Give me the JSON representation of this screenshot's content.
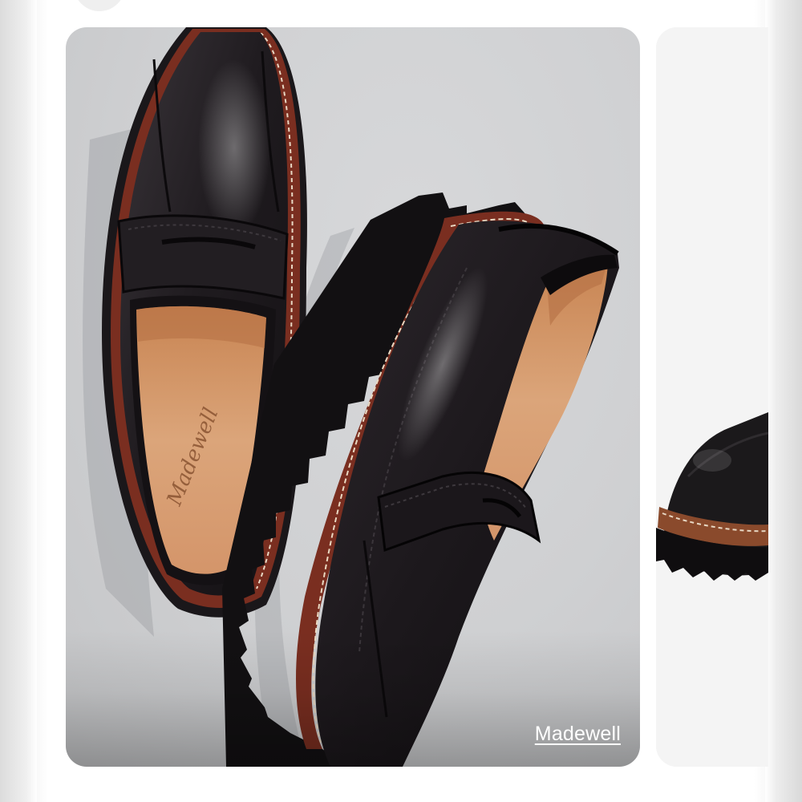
{
  "listing": {
    "primary_card": {
      "brand_link": "Madewell",
      "insole_logo": "Madewell",
      "image_subject": "black-leather-lug-sole-loafers"
    },
    "next_card": {
      "image_subject": "black-leather-lug-sole-loafer-partial"
    }
  },
  "colors": {
    "card_background": "#cfd0d2",
    "leather": "#1f1c1f",
    "welt": "#7a2e20",
    "insole": "#d59a6c",
    "brand_link_text": "#ffffff"
  }
}
